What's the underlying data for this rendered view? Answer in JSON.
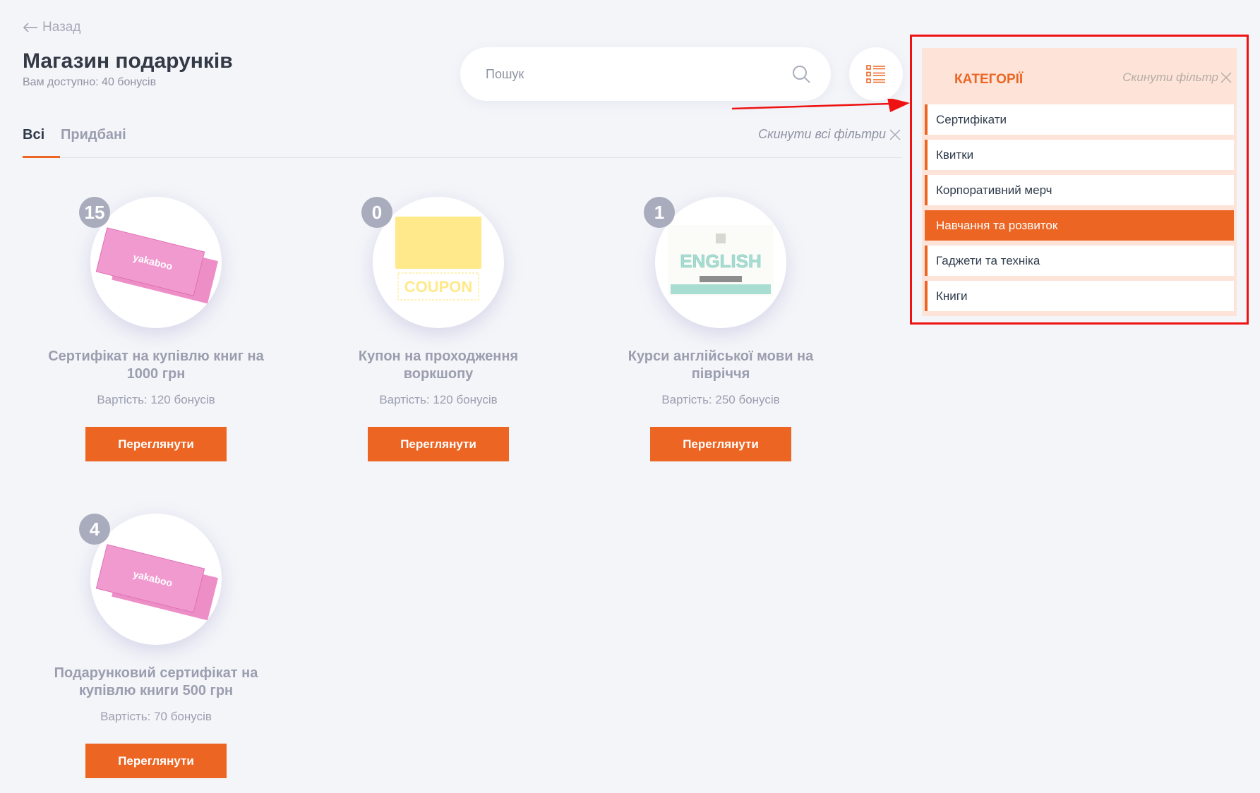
{
  "nav": {
    "back_label": "Назад"
  },
  "header": {
    "title": "Магазин подарунків",
    "subtitle": "Вам доступно: 40 бонусів"
  },
  "search": {
    "placeholder": "Пошук",
    "icon": "search-icon"
  },
  "view_toggle": {
    "icon": "list-icon"
  },
  "tabs": [
    {
      "label": "Всі",
      "active": true
    },
    {
      "label": "Придбані",
      "active": false
    }
  ],
  "reset_all_label": "Скинути всі фільтри",
  "products": [
    {
      "count": "15",
      "name": "Сертифікат на купівлю книг на 1000 грн",
      "price": "Вартість: 120 бонусів",
      "button": "Переглянути",
      "image": "yakaboo",
      "image_text": "yakaboo"
    },
    {
      "count": "0",
      "name": "Купон на проходження воркшопу",
      "price": "Вартість: 120 бонусів",
      "button": "Переглянути",
      "image": "coupon",
      "image_text": "COUPON"
    },
    {
      "count": "1",
      "name": "Курси англійської мови на півріччя",
      "price": "Вартість: 250 бонусів",
      "button": "Переглянути",
      "image": "english",
      "image_text": "ENGLISH"
    },
    {
      "count": "4",
      "name": "Подарунковий сертифікат на купівлю книги 500 грн",
      "price": "Вартість: 70 бонусів",
      "button": "Переглянути",
      "image": "yakaboo",
      "image_text": "yakaboo"
    }
  ],
  "categories": {
    "title": "КАТЕГОРІЇ",
    "reset_label": "Скинути фільтр",
    "items": [
      {
        "label": "Сертифікати",
        "active": false
      },
      {
        "label": "Квитки",
        "active": false
      },
      {
        "label": "Корпоративний мерч",
        "active": false
      },
      {
        "label": "Навчання та розвиток",
        "active": true
      },
      {
        "label": "Гаджети та техніка",
        "active": false
      },
      {
        "label": "Книги",
        "active": false
      }
    ]
  },
  "colors": {
    "accent": "#ec6523",
    "background": "#f4f5f9",
    "highlight_border": "#ee1212",
    "category_panel": "#fde3d8"
  }
}
